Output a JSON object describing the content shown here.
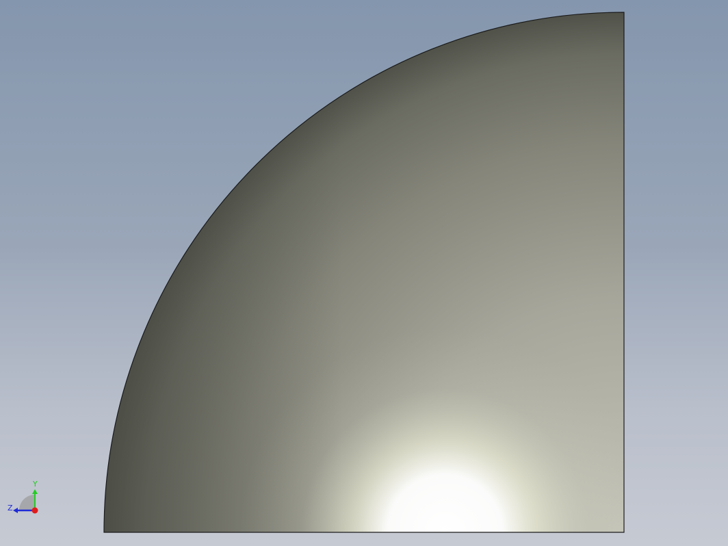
{
  "viewport": {
    "background_top": "#8496ad",
    "background_bottom": "#c6cad3"
  },
  "model": {
    "shape": "quarter-disc",
    "edge_color": "#1a1a1a",
    "shade_dark": "#5f6055",
    "shade_mid": "#8c8c80",
    "shade_light": "#b8b8ae",
    "highlight": "#ffffff"
  },
  "triad": {
    "y_label": "Y",
    "z_label": "Z",
    "y_color": "#22cc22",
    "z_color": "#1f2bd6",
    "x_color": "#e01b1b",
    "icon": "coordinate-triad-icon"
  }
}
